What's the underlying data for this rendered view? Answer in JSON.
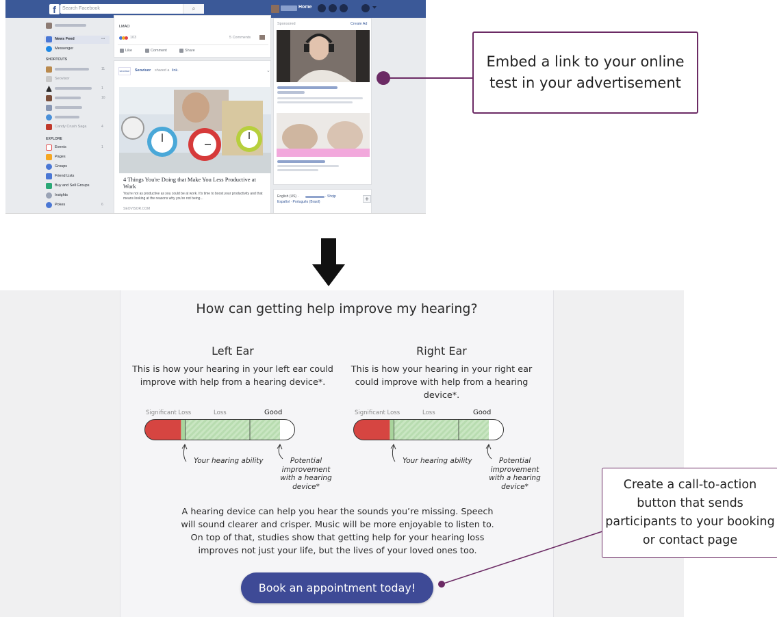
{
  "facebook": {
    "search_placeholder": "Search Facebook",
    "search_icon": "magnifier-icon",
    "nav_home": "Home",
    "left_nav": {
      "news_feed": "News Feed",
      "messenger": "Messenger",
      "shortcuts_heading": "SHORTCUTS",
      "shortcut_visible": "Seovisor",
      "candy": "Candy Crush Saga",
      "explore_heading": "EXPLORE",
      "events": "Events",
      "pages": "Pages",
      "groups": "Groups",
      "friend_lists": "Friend Lists",
      "buy_sell": "Buy and Sell Groups",
      "insights": "Insights",
      "pokes": "Pokes",
      "counts": [
        "11",
        "1",
        "10",
        "4",
        "1",
        "6"
      ]
    },
    "post1": {
      "text": "LMAO",
      "reactions": "103",
      "comments": "5 Comments",
      "like": "Like",
      "comment": "Comment",
      "share": "Share"
    },
    "post2": {
      "page_name": "Seovisor",
      "shared_text": "shared a",
      "link_word": "link.",
      "logo_text": "seovisor",
      "headline": "4 Things You're Doing that Make You Less Productive at Work",
      "excerpt": "You're not as productive as you could be at work. It's time to boost your productivity and that means looking at the reasons why you're not being...",
      "domain": "SEOVISOR.COM"
    },
    "sponsored": {
      "label": "Sponsored",
      "create_ad": "Create Ad"
    },
    "languages": {
      "line1_a": "English (US) ·",
      "line1_b": "· Shqip",
      "line2": "Español · Português (Brasil)",
      "plus": "+"
    }
  },
  "callouts": {
    "top": "Embed a link to your online test in your advertisement",
    "bottom": "Create a call-to-action button that sends participants to your booking or contact page"
  },
  "hearing_page": {
    "title": "How can getting help improve my hearing?",
    "left": {
      "heading": "Left Ear",
      "description": "This is how your hearing in your left ear could improve with help from a hearing device*.",
      "current_level": 0.27,
      "potential_level": 0.9
    },
    "right": {
      "heading": "Right Ear",
      "description": "This is how your hearing in your right ear could improve with help from a hearing device*.",
      "current_level": 0.27,
      "potential_level": 0.9
    },
    "scale": {
      "significant_loss": "Significant Loss",
      "loss": "Loss",
      "good": "Good"
    },
    "annotations": {
      "ability": "Your hearing ability",
      "potential": "Potential improvement with a hearing device*"
    },
    "paragraph": "A hearing device can help you hear the sounds you’re missing. Speech will sound clearer and crisper. Music will be more enjoyable to listen to. On top of that, studies show that getting help for your hearing loss improves not just your life, but the lives of your loved ones too.",
    "cta_label": "Book an appointment today!"
  },
  "colors": {
    "facebook_blue": "#3b5998",
    "callout_border": "#6b2a64",
    "cta_blue": "#3e4a96",
    "loss_red": "#d64541",
    "improve_green": "#b8dcb0"
  }
}
